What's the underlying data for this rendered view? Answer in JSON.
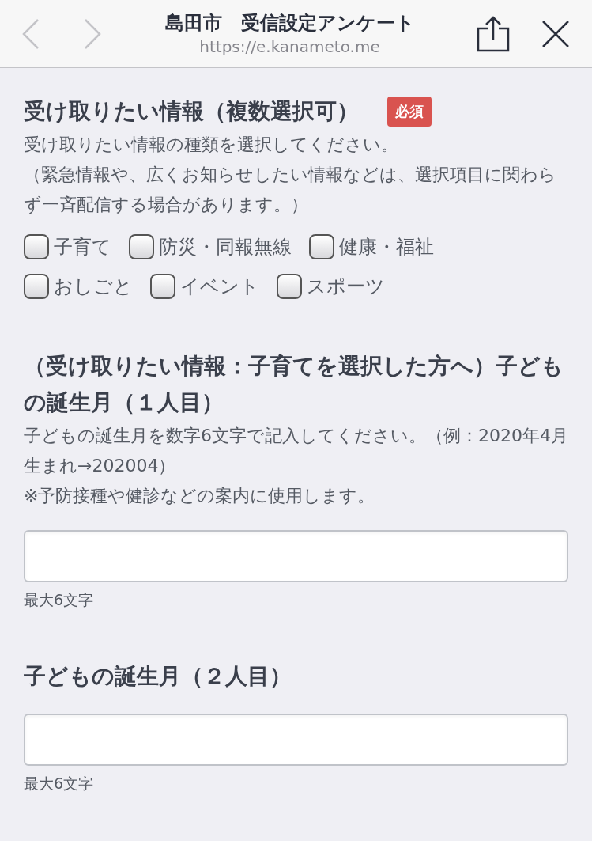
{
  "browser_bar": {
    "title": "島田市　受信設定アンケート",
    "url": "https://e.kanameto.me"
  },
  "questions": [
    {
      "title": "受け取りたい情報（複数選択可）",
      "required_badge": "必須",
      "description": [
        "受け取りたい情報の種類を選択してください。",
        "（緊急情報や、広くお知らせしたい情報などは、選択項目に関わらず一斉配信する場合があります。）"
      ],
      "kind": "checkboxes",
      "options": [
        {
          "label": "子育て",
          "checked": false
        },
        {
          "label": "防災・同報無線",
          "checked": false
        },
        {
          "label": "健康・福祉",
          "checked": false
        },
        {
          "label": "おしごと",
          "checked": false
        },
        {
          "label": "イベント",
          "checked": false
        },
        {
          "label": "スポーツ",
          "checked": false
        }
      ]
    },
    {
      "title": "（受け取りたい情報：子育てを選択した方へ）子どもの誕生月（１人目）",
      "description": [
        "子どもの誕生月を数字6文字で記入してください。（例：2020年4月生まれ→202004）",
        "※予防接種や健診などの案内に使用します。"
      ],
      "kind": "text",
      "hint": "最大6文字"
    },
    {
      "title": "子どもの誕生月（２人目）",
      "kind": "text",
      "hint": "最大6文字"
    }
  ]
}
